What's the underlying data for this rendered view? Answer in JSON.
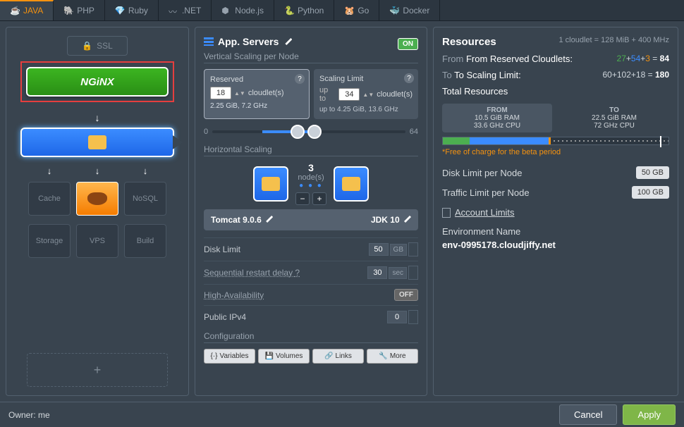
{
  "tabs": [
    "JAVA",
    "PHP",
    "Ruby",
    ".NET",
    "Node.js",
    "Python",
    "Go",
    "Docker"
  ],
  "col1": {
    "ssl": "SSL",
    "nginx": "NGiNX",
    "nodes": {
      "cache": "Cache",
      "nosql": "NoSQL",
      "storage": "Storage",
      "vps": "VPS",
      "build": "Build"
    }
  },
  "appservers": {
    "title": "App. Servers",
    "toggle": "ON",
    "vertical": {
      "label": "Vertical Scaling per Node",
      "reserved": {
        "label": "Reserved",
        "value": "18",
        "unit": "cloudlet(s)",
        "sub": "2.25 GiB, 7.2 GHz"
      },
      "limit": {
        "label": "Scaling Limit",
        "prefix": "up to",
        "value": "34",
        "unit": "cloudlet(s)",
        "sub": "up to 4.25 GiB, 13.6 GHz"
      },
      "slider": {
        "min": "0",
        "max": "64"
      }
    },
    "horizontal": {
      "label": "Horizontal Scaling",
      "count": "3",
      "unit": "node(s)"
    },
    "stack": {
      "name": "Tomcat 9.0.6",
      "jdk": "JDK 10"
    },
    "settings": {
      "disk": {
        "label": "Disk Limit",
        "val": "50",
        "unit": "GB"
      },
      "restart": {
        "label": "Sequential restart delay",
        "val": "30",
        "unit": "sec"
      },
      "ha": {
        "label": "High-Availability",
        "val": "OFF"
      },
      "ipv4": {
        "label": "Public IPv4",
        "val": "0"
      },
      "config": {
        "label": "Configuration",
        "variables": "Variables",
        "volumes": "Volumes",
        "links": "Links",
        "more": "More"
      }
    }
  },
  "resources": {
    "title": "Resources",
    "note": "1 cloudlet = 128 MiB + 400 MHz",
    "from": {
      "label": "From Reserved Cloudlets:",
      "a": "27",
      "b": "54",
      "c": "3",
      "total": "84"
    },
    "to": {
      "label": "To Scaling Limit:",
      "a": "60",
      "b": "102",
      "c": "18",
      "total": "180"
    },
    "totalLabel": "Total Resources",
    "fromBox": {
      "label": "FROM",
      "ram": "10.5 GiB RAM",
      "cpu": "33.6 GHz CPU"
    },
    "toBox": {
      "label": "TO",
      "ram": "22.5 GiB RAM",
      "cpu": "72 GHz CPU"
    },
    "freeNote": "*Free of charge for the beta period",
    "diskLimit": {
      "label": "Disk Limit per Node",
      "value": "50 GB"
    },
    "trafficLimit": {
      "label": "Traffic Limit per Node",
      "value": "100 GB"
    },
    "accountLimits": "Account Limits",
    "envLabel": "Environment Name",
    "envValue": "env-0995178.cloudjiffy.net"
  },
  "footer": {
    "owner": "Owner: me",
    "cancel": "Cancel",
    "apply": "Apply"
  }
}
